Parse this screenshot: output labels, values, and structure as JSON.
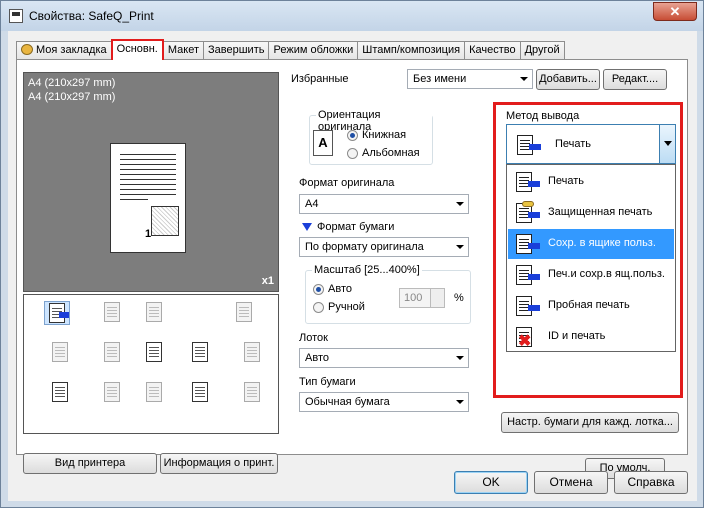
{
  "window": {
    "title": "Свойства: SafeQ_Print",
    "close_label": "✕"
  },
  "tabs": [
    "Моя закладка",
    "Основн.",
    "Макет",
    "Завершить",
    "Режим обложки",
    "Штамп/композиция",
    "Качество",
    "Другой"
  ],
  "preview": {
    "caption_line1": "A4 (210x297 mm)",
    "caption_line2": "A4 (210x297 mm)",
    "page_number": "1",
    "copies_badge": "x1"
  },
  "left_buttons": {
    "printer_view": "Вид принтера",
    "printer_info": "Информация о принт."
  },
  "favorites": {
    "label": "Избранные",
    "value": "Без имени",
    "add_label": "Добавить...",
    "edit_label": "Редакт...."
  },
  "orientation": {
    "title": "Ориентация оригинала",
    "portrait": "Книжная",
    "landscape": "Альбомная",
    "icon_letter": "A"
  },
  "original_size": {
    "label": "Формат оригинала",
    "value": "A4"
  },
  "paper_size": {
    "label": "Формат бумаги",
    "value": "По формату оригинала"
  },
  "zoom": {
    "title": "Масштаб [25...400%]",
    "auto": "Авто",
    "manual": "Ручной",
    "value": "100",
    "unit": "%"
  },
  "tray": {
    "label": "Лоток",
    "value": "Авто"
  },
  "paper_type": {
    "label": "Тип бумаги",
    "value": "Обычная бумага"
  },
  "output": {
    "label": "Метод вывода",
    "selected": "Печать",
    "options": [
      {
        "label": "Печать",
        "icon": "print-icon"
      },
      {
        "label": "Защищенная печать",
        "icon": "secure-print-icon"
      },
      {
        "label": "Сохр. в ящике польз.",
        "icon": "save-box-icon"
      },
      {
        "label": "Печ.и сохр.в ящ.польз.",
        "icon": "print-save-icon"
      },
      {
        "label": "Пробная печать",
        "icon": "proof-print-icon"
      },
      {
        "label": "ID и печать",
        "icon": "id-print-icon"
      }
    ],
    "highlighted_index": 2
  },
  "tray_settings_label": "Настр. бумаги для кажд. лотка...",
  "defaults_label": "По умолч.",
  "dialog": {
    "ok": "OK",
    "cancel": "Отмена",
    "help": "Справка"
  },
  "colors": {
    "accent_red": "#e21c1c",
    "selection_blue": "#3399ff",
    "arrow_blue": "#1a3fd9"
  }
}
